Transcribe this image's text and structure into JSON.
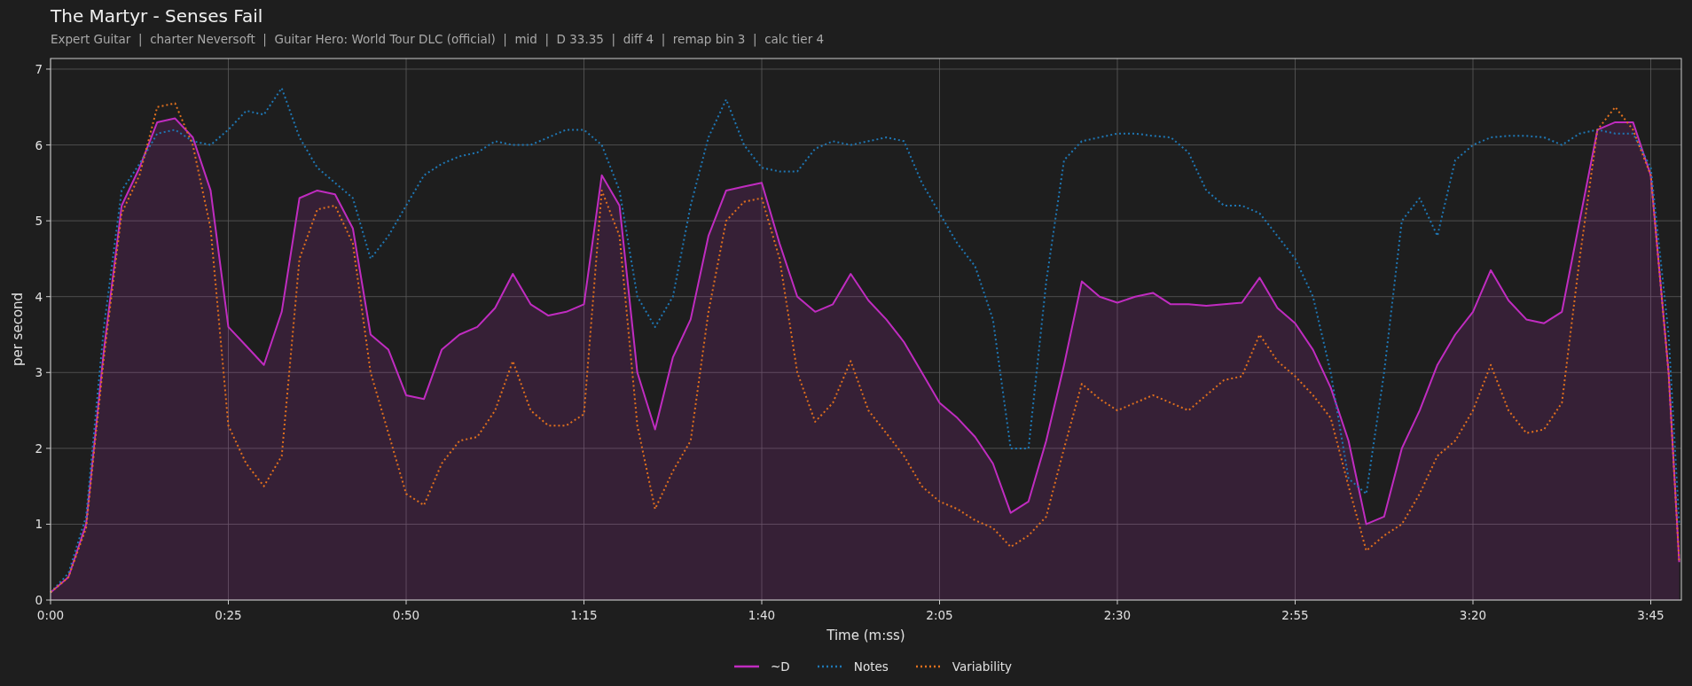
{
  "header": {
    "title": "The Martyr - Senses Fail",
    "subtitle": "Expert Guitar  |  charter Neversoft  |  Guitar Hero: World Tour DLC (official)  |  mid  |  D 33.35  |  diff 4  |  remap bin 3  |  calc tier 4"
  },
  "chart": {
    "chart_data": {
      "type": "line",
      "grid": true,
      "xlabel": "Time (m:ss)",
      "ylabel": "per second",
      "x": [
        0,
        2.5,
        5,
        7.5,
        10,
        12.5,
        15,
        17.5,
        20,
        22.5,
        25,
        27.5,
        30,
        32.5,
        35,
        37.5,
        40,
        42.5,
        45,
        47.5,
        50,
        52.5,
        55,
        57.5,
        60,
        62.5,
        65,
        67.5,
        70,
        72.5,
        75,
        77.5,
        80,
        82.5,
        85,
        87.5,
        90,
        92.5,
        95,
        97.5,
        100,
        102.5,
        105,
        107.5,
        110,
        112.5,
        115,
        117.5,
        120,
        122.5,
        125,
        127.5,
        130,
        132.5,
        135,
        137.5,
        140,
        142.5,
        145,
        147.5,
        150,
        152.5,
        155,
        157.5,
        160,
        162.5,
        165,
        167.5,
        170,
        172.5,
        175,
        177.5,
        180,
        182.5,
        185,
        187.5,
        190,
        192.5,
        195,
        197.5,
        200,
        202.5,
        205,
        207.5,
        210,
        212.5,
        215,
        217.5,
        220,
        222.5,
        225,
        227.5,
        229
      ],
      "series": [
        {
          "name": "~D",
          "color": "#c02cc0",
          "line_style": "solid",
          "type": "area",
          "values": [
            0.1,
            0.3,
            1.0,
            3.3,
            5.2,
            5.7,
            6.3,
            6.35,
            6.1,
            5.4,
            3.6,
            3.35,
            3.1,
            3.8,
            5.3,
            5.4,
            5.35,
            4.9,
            3.5,
            3.3,
            2.7,
            2.65,
            3.3,
            3.5,
            3.6,
            3.85,
            4.3,
            3.9,
            3.75,
            3.8,
            3.9,
            5.6,
            5.2,
            3.0,
            2.25,
            3.2,
            3.7,
            4.8,
            5.4,
            5.45,
            5.5,
            4.7,
            4.0,
            3.8,
            3.9,
            4.3,
            3.95,
            3.7,
            3.4,
            3.0,
            2.6,
            2.4,
            2.15,
            1.8,
            1.15,
            1.3,
            2.1,
            3.1,
            4.2,
            4.0,
            3.92,
            4.0,
            4.05,
            3.9,
            3.9,
            3.88,
            3.9,
            3.92,
            4.25,
            3.85,
            3.65,
            3.3,
            2.8,
            2.1,
            1.0,
            1.1,
            2.0,
            2.5,
            3.1,
            3.5,
            3.8,
            4.35,
            3.95,
            3.7,
            3.65,
            3.8,
            5.0,
            6.2,
            6.3,
            6.3,
            5.6,
            3.0,
            0.5
          ]
        },
        {
          "name": "Notes",
          "color": "#1f77b4",
          "line_style": "dotted",
          "type": "line",
          "values": [
            0.1,
            0.35,
            1.1,
            3.6,
            5.4,
            5.75,
            6.15,
            6.2,
            6.05,
            6.0,
            6.2,
            6.45,
            6.4,
            6.75,
            6.1,
            5.7,
            5.5,
            5.3,
            4.5,
            4.8,
            5.2,
            5.6,
            5.75,
            5.85,
            5.9,
            6.05,
            6.0,
            6.0,
            6.1,
            6.2,
            6.2,
            6.0,
            5.4,
            4.0,
            3.6,
            4.0,
            5.2,
            6.1,
            6.6,
            6.0,
            5.7,
            5.65,
            5.65,
            5.95,
            6.05,
            6.0,
            6.05,
            6.1,
            6.05,
            5.5,
            5.1,
            4.7,
            4.4,
            3.7,
            2.0,
            2.0,
            4.2,
            5.8,
            6.05,
            6.1,
            6.15,
            6.15,
            6.12,
            6.1,
            5.9,
            5.4,
            5.2,
            5.2,
            5.1,
            4.8,
            4.5,
            4.0,
            3.0,
            1.6,
            1.4,
            3.0,
            5.0,
            5.3,
            4.8,
            5.8,
            6.0,
            6.1,
            6.12,
            6.12,
            6.1,
            6.0,
            6.15,
            6.2,
            6.15,
            6.15,
            5.7,
            3.5,
            1.0
          ]
        },
        {
          "name": "Variability",
          "color": "#e0701e",
          "line_style": "dotted",
          "type": "line",
          "values": [
            0.1,
            0.3,
            0.95,
            3.2,
            5.1,
            5.6,
            6.5,
            6.55,
            6.0,
            4.9,
            2.3,
            1.8,
            1.5,
            1.9,
            4.5,
            5.15,
            5.2,
            4.7,
            3.0,
            2.2,
            1.4,
            1.25,
            1.8,
            2.1,
            2.15,
            2.5,
            3.15,
            2.5,
            2.3,
            2.3,
            2.45,
            5.4,
            4.8,
            2.3,
            1.2,
            1.7,
            2.1,
            3.8,
            5.0,
            5.25,
            5.3,
            4.5,
            3.0,
            2.35,
            2.6,
            3.15,
            2.5,
            2.2,
            1.9,
            1.5,
            1.3,
            1.2,
            1.05,
            0.95,
            0.7,
            0.85,
            1.1,
            2.0,
            2.85,
            2.65,
            2.5,
            2.6,
            2.7,
            2.6,
            2.5,
            2.7,
            2.9,
            2.95,
            3.5,
            3.15,
            2.95,
            2.7,
            2.4,
            1.5,
            0.65,
            0.85,
            1.0,
            1.4,
            1.9,
            2.1,
            2.5,
            3.1,
            2.5,
            2.2,
            2.25,
            2.6,
            4.5,
            6.2,
            6.5,
            6.2,
            5.6,
            3.0,
            0.5
          ]
        }
      ],
      "xlim": [
        0,
        229.3
      ],
      "ylim": [
        0,
        7.14
      ],
      "xticks": [
        {
          "value": 0,
          "label": "0:00"
        },
        {
          "value": 25,
          "label": "0:25"
        },
        {
          "value": 50,
          "label": "0:50"
        },
        {
          "value": 75,
          "label": "1:15"
        },
        {
          "value": 100,
          "label": "1:40"
        },
        {
          "value": 125,
          "label": "2:05"
        },
        {
          "value": 150,
          "label": "2:30"
        },
        {
          "value": 175,
          "label": "2:55"
        },
        {
          "value": 200,
          "label": "3:20"
        },
        {
          "value": 225,
          "label": "3:45"
        }
      ],
      "yticks": [
        0,
        1,
        2,
        3,
        4,
        5,
        6,
        7
      ]
    }
  }
}
